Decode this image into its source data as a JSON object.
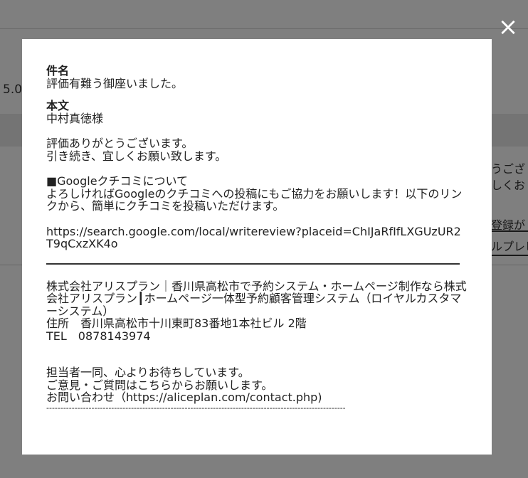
{
  "background": {
    "rating": "5.0",
    "snippets": [
      "うござ",
      "しくお",
      "登録が",
      "ルプレビ"
    ]
  },
  "modal": {
    "close_icon": "×",
    "subject_label": "件名",
    "subject_value": "評価有難う御座いました。",
    "body_label": "本文",
    "recipient": "中村真徳様",
    "greeting_1": "評価ありがとうございます。",
    "greeting_2": "引き続き、宜しくお願い致します。",
    "google_heading": "■Googleクチコミについて",
    "google_text": "よろしければGoogleのクチコミへの投稿にもご協力をお願いします！以下のリンクから、簡単にクチコミを投稿いただけます。",
    "review_url": "https://search.google.com/local/writereview?placeid=ChIJaRfIfLXGUzUR2T9qCxzXK4o",
    "company_line": "株式会社アリスプラン｜香川県高松市で予約システム・ホームページ制作なら株式会社アリスプラン┃ホームページ一体型予約顧客管理システム（ロイヤルカスタマーシステム）",
    "address": "住所　香川県高松市十川東町83番地1本社ビル 2階",
    "tel": "TEL　0878143974",
    "closing_1": "担当者一同、心よりお待ちしています。",
    "closing_2": "ご意見・ご質問はこちらからお願いします。",
    "contact": "お問い合わせ（https://aliceplan.com/contact.php)",
    "dash_line": "----------------------------------------------------------------------------------------------------------------"
  }
}
